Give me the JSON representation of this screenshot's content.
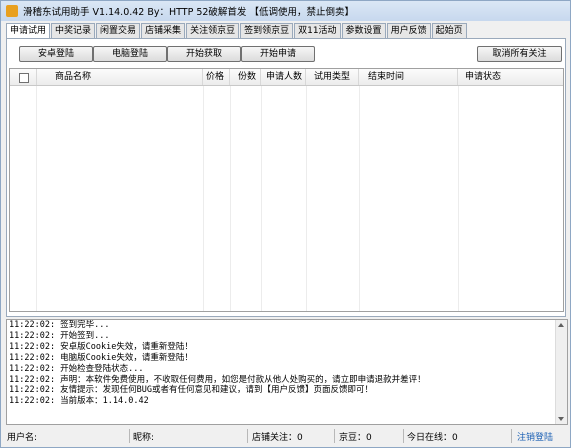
{
  "window": {
    "title": "滑稽东试用助手 V1.14.0.42  By：HTTP 52破解首发 【低调使用，禁止倒卖】"
  },
  "tabs": [
    "申请试用",
    "中奖记录",
    "闲置交易",
    "店铺采集",
    "关注领京豆",
    "签到领京豆",
    "双11活动",
    "参数设置",
    "用户反馈",
    "起始页"
  ],
  "toolbar": {
    "android_login": "安卓登陆",
    "pc_login": "电脑登陆",
    "start_fetch": "开始获取",
    "start_apply": "开始申请",
    "cancel_follow": "取消所有关注"
  },
  "table": {
    "columns": [
      "商品名称",
      "价格",
      "份数",
      "申请人数",
      "试用类型",
      "结束时间",
      "申请状态"
    ],
    "rows": []
  },
  "log": [
    "11:22:02: 签到完毕...",
    "11:22:02: 开始签到...",
    "11:22:02: 安卓版Cookie失效，请重新登陆！",
    "11:22:02: 电脑版Cookie失效，请重新登陆！",
    "11:22:02: 开始检查登陆状态...",
    "11:22:02: 声明：本软件免费使用，不收取任何费用，如您是付款从他人处购买的，请立即申请退款并差评！",
    "11:22:02: 友情提示：发现任何BUG或者有任何意见和建议，请到【用户反馈】页面反馈即可！",
    "11:22:02: 当前版本：1.14.0.42"
  ],
  "status": {
    "user": "用户名:",
    "nickname": "昵称:",
    "shop_follow": "店铺关注：0",
    "jingdou": "京豆：0",
    "today_online": "今日在线：0",
    "logout": "注销登陆"
  }
}
